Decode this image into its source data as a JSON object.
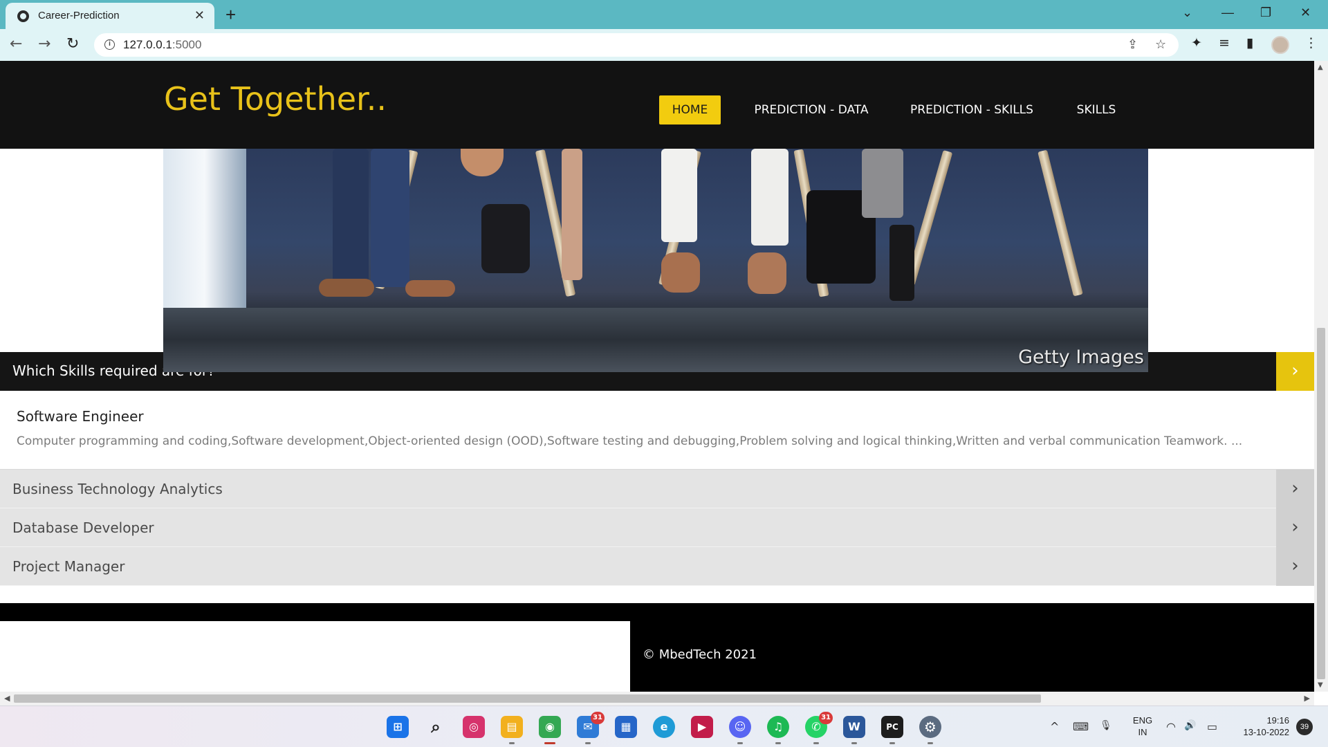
{
  "browser": {
    "tab_title": "Career-Prediction",
    "tab_close": "✕",
    "new_tab": "+",
    "url_host": "127.0.0.1",
    "url_port": ":5000",
    "back": "←",
    "forward": "→",
    "reload": "↻",
    "minimize": "—",
    "restore": "❐",
    "close": "✕",
    "tab_search": "⌄",
    "share": "⇪",
    "bookmark": "☆",
    "extensions": "✦",
    "media": "≡",
    "sidepanel": "▮",
    "menu": "⋮"
  },
  "site": {
    "brand": "Get Together..",
    "nav": [
      {
        "label": "HOME",
        "active": true
      },
      {
        "label": "PREDICTION - DATA",
        "active": false
      },
      {
        "label": "PREDICTION - SKILLS",
        "active": false
      },
      {
        "label": "SKILLS",
        "active": false
      }
    ]
  },
  "hero": {
    "credit": "Getty Images"
  },
  "skills_section": {
    "title": "Which Skills required are for?",
    "arrow": "›",
    "active_item": {
      "heading": "Software Engineer",
      "description": "Computer programming and coding,Software development,Object-oriented design (OOD),Software testing and debugging,Problem solving and logical thinking,Written and verbal communication Teamwork. ..."
    },
    "items": [
      {
        "label": "Business Technology Analytics",
        "chevron": "›"
      },
      {
        "label": "Database Developer",
        "chevron": "›"
      },
      {
        "label": "Project Manager",
        "chevron": "›"
      }
    ]
  },
  "footer": {
    "copyright": "© MbedTech 2021"
  },
  "scrollbars": {
    "up": "▲",
    "down": "▼",
    "left": "◀",
    "right": "▶"
  },
  "taskbar": {
    "apps": [
      {
        "name": "start",
        "glyph": "⊞",
        "color": "#1a73e8"
      },
      {
        "name": "search",
        "glyph": "⌕",
        "color": "#e9edf5"
      },
      {
        "name": "instagram",
        "glyph": "◎",
        "color": "#d6336c"
      },
      {
        "name": "file-explorer",
        "glyph": "▤",
        "color": "#f2b01e"
      },
      {
        "name": "chrome",
        "glyph": "◉",
        "color": "#34a853"
      },
      {
        "name": "mail",
        "glyph": "✉",
        "color": "#2f7bd6",
        "badge": "31"
      },
      {
        "name": "store",
        "glyph": "▦",
        "color": "#2666c8"
      },
      {
        "name": "edge",
        "glyph": "e",
        "color": "#1f9bd6"
      },
      {
        "name": "app-red",
        "glyph": "▶",
        "color": "#c21d4a"
      },
      {
        "name": "discord",
        "glyph": "☺",
        "color": "#5865f2"
      },
      {
        "name": "spotify",
        "glyph": "♫",
        "color": "#1db954"
      },
      {
        "name": "whatsapp",
        "glyph": "✆",
        "color": "#25d366",
        "badge": "31"
      },
      {
        "name": "word",
        "glyph": "W",
        "color": "#2b579a"
      },
      {
        "name": "pycharm",
        "glyph": "PC",
        "color": "#1d1d1d"
      },
      {
        "name": "settings",
        "glyph": "⚙",
        "color": "#5b6b80"
      }
    ],
    "tray": {
      "chevron": "^",
      "keyboard": "⌨",
      "mic": "🎙",
      "lang_top": "ENG",
      "lang_bottom": "IN",
      "wifi": "◠",
      "volume": "🔊",
      "battery": "▭",
      "time": "19:16",
      "date": "13-10-2022",
      "notifications": "39"
    }
  }
}
